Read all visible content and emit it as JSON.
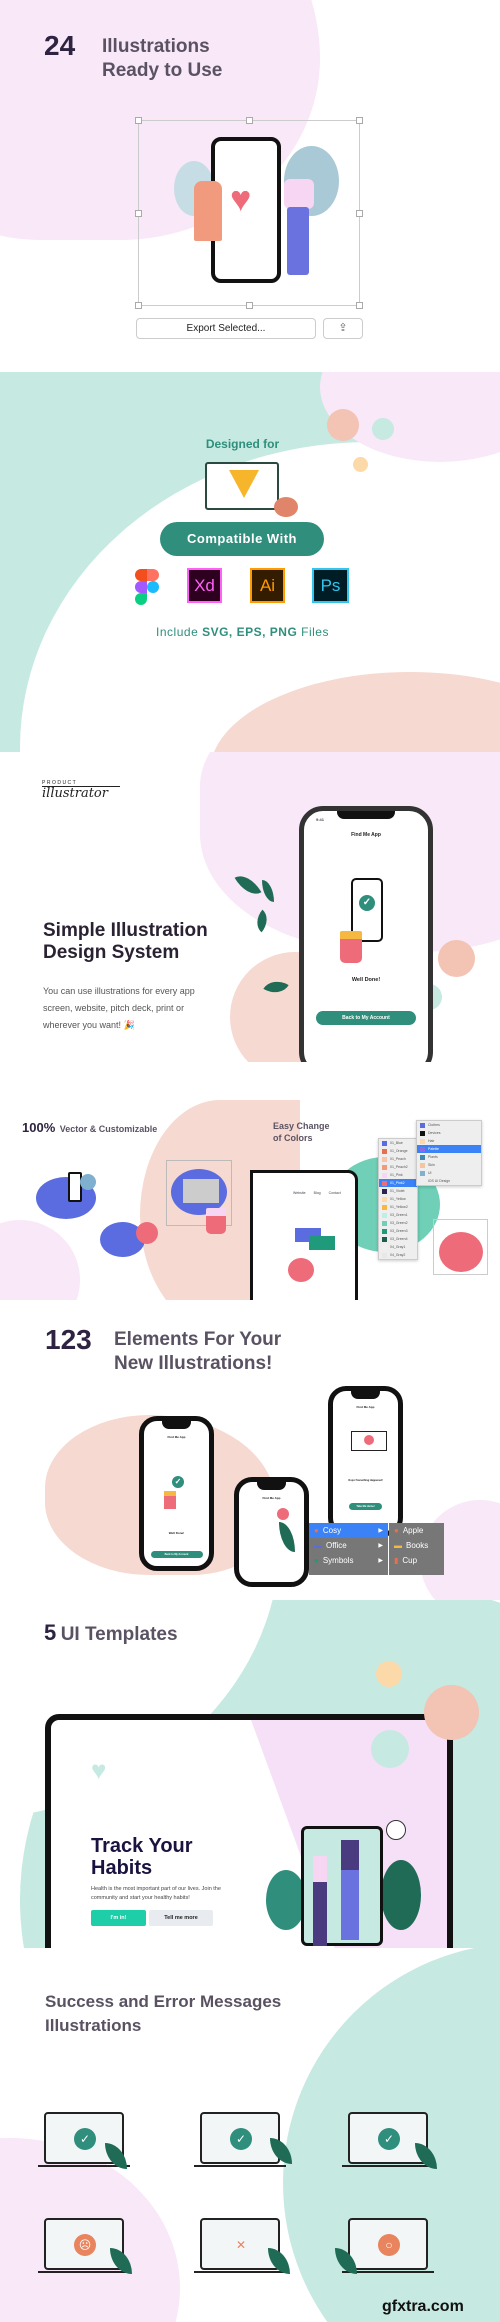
{
  "hero": {
    "count": "24",
    "title_line1": "Illustrations",
    "title_line2": "Ready to Use",
    "export_label": "Export Selected...",
    "share_icon": "share-icon"
  },
  "compat": {
    "designed_for": "Designed for",
    "compatible_label": "Compatible With",
    "apps": [
      "Xd",
      "Ai",
      "Ps"
    ],
    "include_prefix": "Include ",
    "formats": "SVG, EPS, PNG",
    "include_suffix": " Files",
    "colors": {
      "teal": "#2f8f7c",
      "mint": "#c6e9e2",
      "pink": "#f8e8f8",
      "peach": "#f6d9d0"
    }
  },
  "system": {
    "logo_top": "PRODUCT",
    "logo_script": "illustrator",
    "title_line1": "Simple Illustration",
    "title_line2": "Design System",
    "paragraph": "You can use illustrations for every app screen, website, pitch deck, print or wherever you want!",
    "party_icon": "🎉",
    "phone": {
      "time": "9:41",
      "app_title": "Find Me App",
      "message": "Well Done!",
      "button": "Back to My Account"
    }
  },
  "features": {
    "vector_count": "100%",
    "vector_label": "Vector & Customizable",
    "colors_line1": "Easy Change",
    "colors_line2": "of Colors",
    "web_nav": [
      "Website",
      "Blog",
      "Contact"
    ],
    "menu_main": [
      "Clothes",
      "Devices",
      "Hair",
      "Palette",
      "Plants",
      "Skin",
      "UI",
      "iOS UI Design"
    ],
    "menu_palette": [
      "01_Blue",
      "01_Orange",
      "01_Peach",
      "01_Peach2",
      "01_Pink",
      "01_Pink2",
      "01_Violet",
      "01_Yellow",
      "01_Yellow2",
      "03_Green1",
      "03_Green2",
      "03_Green3",
      "03_Green4",
      "04_Gray1",
      "04_Gray2"
    ],
    "menu_palette_colors": [
      "#5b6be0",
      "#e86f4c",
      "#f7c3ad",
      "#f29a7e",
      "#f6d6f2",
      "#ee6b7a",
      "#2e2350",
      "#fbd9a8",
      "#f5b942",
      "#bfeee5",
      "#6fcfb7",
      "#1f9a7a",
      "#1b5e4b",
      "#f0f0f0",
      "#e8e8e8"
    ],
    "menu_main_colors": [
      "#5b6be0",
      "#111111",
      "#fbd9a8",
      "#8a6be0",
      "#3d8bb0",
      "#f3c6a0",
      "#7fb0d0",
      ""
    ]
  },
  "elements": {
    "count": "123",
    "title_line1": "Elements For Your",
    "title_line2": "New Illustrations!",
    "phone1": {
      "app_title": "Find Me App",
      "message": "Well Done!",
      "button": "Back to My Account"
    },
    "phone2": {
      "app_title": "Find Me App"
    },
    "phone3": {
      "app_title": "Find Me App",
      "message": "Oops! Something Happened!",
      "button": "Take Me Home!"
    },
    "menu": [
      "Cosy",
      "Office",
      "Symbols"
    ],
    "submenu": [
      "Apple",
      "Books",
      "Cup"
    ]
  },
  "templates": {
    "count": "5",
    "title": "UI Templates",
    "hero_title_line1": "Track Your",
    "hero_title_line2": "Habits",
    "hero_text": "Health is the most important part of our lives. Join the community and start your healthy habits!",
    "primary_button": "I'm in!",
    "secondary_button": "Tell me more"
  },
  "messages": {
    "title_line1": "Success and Error Messages",
    "title_line2": "Illustrations",
    "watermark": "gfxtra.com",
    "items": [
      {
        "type": "success",
        "icon": "check-icon"
      },
      {
        "type": "success",
        "icon": "check-icon"
      },
      {
        "type": "success",
        "icon": "check-icon"
      },
      {
        "type": "error",
        "icon": "sad-face-icon"
      },
      {
        "type": "error",
        "icon": "x-icon"
      },
      {
        "type": "error",
        "icon": "surprised-face-icon"
      }
    ]
  }
}
